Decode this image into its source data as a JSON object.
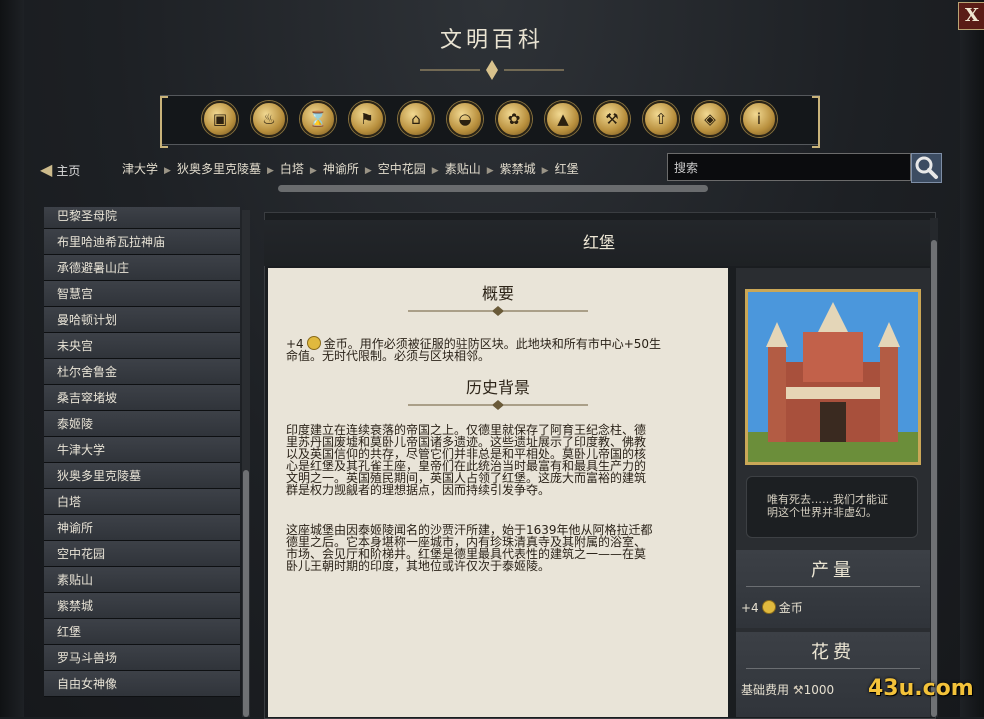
{
  "window": {
    "title": "文明百科",
    "close_label": "X"
  },
  "categories": [
    "resources-icon",
    "amenities-icon",
    "era-icon",
    "civilizations-icon",
    "buildings-icon",
    "districts-icon",
    "wonders-icon",
    "terrain-icon",
    "improvements-icon",
    "units-icon",
    "policies-icon",
    "info-icon"
  ],
  "nav": {
    "home_label": "主页",
    "breadcrumbs": [
      "津大学",
      "狄奥多里克陵墓",
      "白塔",
      "神谕所",
      "空中花园",
      "素贴山",
      "紫禁城",
      "红堡"
    ],
    "search_placeholder": "搜索"
  },
  "sidebar": {
    "items": [
      "巴黎圣母院",
      "布里哈迪希瓦拉神庙",
      "承德避暑山庄",
      "智慧宫",
      "曼哈顿计划",
      "未央宫",
      "杜尔舍鲁金",
      "桑吉窣堵坡",
      "泰姬陵",
      "牛津大学",
      "狄奥多里克陵墓",
      "白塔",
      "神谕所",
      "空中花园",
      "素贴山",
      "紫禁城",
      "红堡",
      "罗马斗兽场",
      "自由女神像"
    ]
  },
  "entry": {
    "title": "红堡",
    "summary_heading": "概要",
    "summary_prefix": "+4",
    "summary_line1": "金币。用作必须被征服的驻防区块。此地块和所有市中心+50生",
    "summary_line2": "命值。无时代限制。必须与区块相邻。",
    "history_heading": "历史背景",
    "history_p1": [
      "印度建立在连续衰落的帝国之上。仅德里就保存了阿育王纪念柱、德",
      "里苏丹国废墟和莫卧儿帝国诸多遗迹。这些遗址展示了印度教、佛教",
      "以及英国信仰的共存，尽管它们并非总是和平相处。莫卧儿帝国的核",
      "心是红堡及其孔雀王座，皇帝们在此统治当时最富有和最具生产力的",
      "文明之一。英国殖民期间，英国人占领了红堡。这庞大而富裕的建筑",
      "群是权力觊觎者的理想据点，因而持续引发争夺。"
    ],
    "history_p2": [
      "这座城堡由因泰姬陵闻名的沙贾汗所建，始于1639年他从阿格拉迁都",
      "德里之后。它本身堪称一座城市，内有珍珠清真寺及其附属的浴室、",
      "市场、会见厅和阶梯井。红堡是德里最具代表性的建筑之一——在莫",
      "卧儿王朝时期的印度，其地位或许仅次于泰姬陵。"
    ],
    "quote": [
      "唯有死去……我们才能证",
      "明这个世界并非虚幻。"
    ],
    "yield_heading": "产量",
    "yield_prefix": "+4",
    "yield_value": "金币",
    "cost_heading": "花费",
    "cost_label": "基础费用",
    "cost_value": "1000"
  },
  "watermark": "43u.com",
  "colors": {
    "accent_gold": "#caa757",
    "coin": "#e0b93e",
    "sky": "#3f8dd6"
  }
}
